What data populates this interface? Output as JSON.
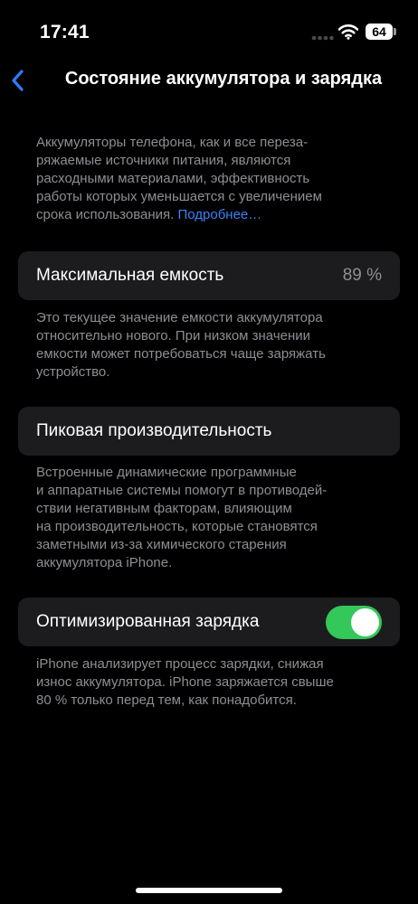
{
  "status_bar": {
    "time": "17:41",
    "battery_level": "64",
    "icons": [
      "signal-icon",
      "wifi-icon",
      "battery-icon"
    ]
  },
  "nav": {
    "back_icon": "chevron-left-icon",
    "title": "Состояние аккумулятора и зарядка"
  },
  "intro": {
    "lines": [
      "Аккумуляторы телефона, как и все переза-",
      "ряжаемые источники питания, являются",
      "расходными материалами, эффективность",
      "работы которых уменьшается с увеличением"
    ],
    "last_line_text": "срока использования. ",
    "link_label": "Подробнее…"
  },
  "max_capacity": {
    "label": "Максимальная емкость",
    "value": "89 %",
    "footnote_lines": [
      "Это текущее значение емкости аккумулятора",
      "относительно нового. При низком значении",
      "емкости может потребоваться чаще заряжать",
      "устройство."
    ]
  },
  "peak_performance": {
    "label": "Пиковая производительность",
    "footnote_lines": [
      "Встроенные динамические программные",
      "и аппаратные системы помогут в противодей-",
      "ствии негативным факторам, влияющим",
      "на производительность, которые становятся",
      "заметными из-за химического старения",
      "аккумулятора iPhone."
    ]
  },
  "optimized_charging": {
    "label": "Оптимизированная зарядка",
    "enabled": true,
    "toggle_color": "#34c759",
    "footnote_lines": [
      "iPhone анализирует процесс зарядки, снижая",
      "износ аккумулятора. iPhone заряжается свыше",
      "80 % только перед тем, как понадобится."
    ]
  },
  "colors": {
    "background": "#000000",
    "cell_background": "#1c1c1e",
    "secondary_text": "#8e8e93",
    "link": "#3b82f6"
  }
}
